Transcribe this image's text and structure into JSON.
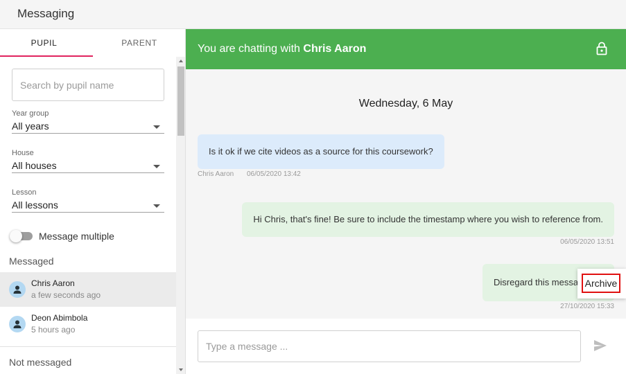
{
  "app": {
    "title": "Messaging"
  },
  "tabs": [
    {
      "label": "PUPIL",
      "active": true
    },
    {
      "label": "PARENT",
      "active": false
    }
  ],
  "search": {
    "placeholder": "Search by pupil name"
  },
  "filters": {
    "year_group": {
      "label": "Year group",
      "value": "All years"
    },
    "house": {
      "label": "House",
      "value": "All houses"
    },
    "lesson": {
      "label": "Lesson",
      "value": "All lessons"
    }
  },
  "message_multiple": {
    "label": "Message multiple",
    "enabled": false
  },
  "messaged": {
    "header": "Messaged",
    "contacts": [
      {
        "name": "Chris Aaron",
        "time": "a few seconds ago",
        "active": true,
        "icon": "person-icon"
      },
      {
        "name": "Deon Abimbola",
        "time": "5 hours ago",
        "active": false,
        "icon": "person-icon"
      }
    ]
  },
  "not_messaged": {
    "header": "Not messaged"
  },
  "chat": {
    "header_prefix": "You are chatting with ",
    "contact_name": "Chris Aaron",
    "header_icon": "lock-icon",
    "date": "Wednesday, 6 May",
    "messages": [
      {
        "direction": "in",
        "text": "Is it ok if we cite videos as a source for this coursework?",
        "sender": "Chris Aaron",
        "timestamp": "06/05/2020 13:42"
      },
      {
        "direction": "out",
        "text": "Hi Chris, that's fine! Be sure to include the timestamp where you wish to reference from.",
        "timestamp": "06/05/2020 13:51"
      },
      {
        "direction": "out",
        "text": "Disregard this message",
        "timestamp": "27/10/2020 15:33"
      }
    ],
    "context_menu": {
      "item": "Archive"
    }
  },
  "composer": {
    "placeholder": "Type a message ...",
    "send_icon": "send-icon"
  },
  "colors": {
    "header_green": "#4caf50",
    "tab_accent": "#e0245e",
    "incoming_bubble": "#dcebfb",
    "outgoing_bubble": "#e3f3e3",
    "highlight_red": "#e01010"
  }
}
